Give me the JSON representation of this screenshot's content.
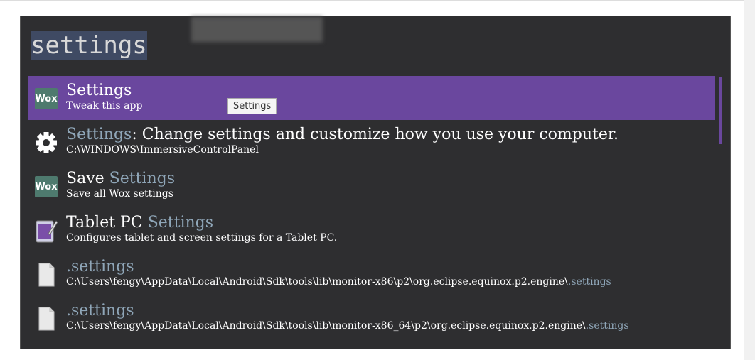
{
  "query": "settings",
  "tooltip": "Settings",
  "accent_color": "#6a479e",
  "highlight_color": "#8fa6b8",
  "results": [
    {
      "icon": "wox-icon",
      "icon_text": "Wox",
      "title_pre": "Settings",
      "title_hl": "",
      "title_post": "",
      "sub_pre": "Tweak this app",
      "sub_hl": "",
      "selected": true
    },
    {
      "icon": "gear-icon",
      "title_pre": "",
      "title_hl": "Settings",
      "title_post": ": Change settings and customize how you use your computer.",
      "sub_pre": "C:\\WINDOWS\\ImmersiveControlPanel",
      "sub_hl": ""
    },
    {
      "icon": "wox-icon",
      "icon_text": "Wox",
      "title_pre": "Save ",
      "title_hl": "Settings",
      "title_post": "",
      "sub_pre": "Save all Wox settings",
      "sub_hl": ""
    },
    {
      "icon": "tablet-pc-icon",
      "title_pre": "Tablet PC ",
      "title_hl": "Settings",
      "title_post": "",
      "sub_pre": "Configures tablet and screen settings for a Tablet PC.",
      "sub_hl": ""
    },
    {
      "icon": "file-icon",
      "title_pre": "",
      "title_hl": ".settings",
      "title_post": "",
      "sub_pre": "C:\\Users\\fengy\\AppData\\Local\\Android\\Sdk\\tools\\lib\\monitor-x86\\p2\\org.eclipse.equinox.p2.engine\\",
      "sub_hl": ".settings"
    },
    {
      "icon": "file-icon",
      "title_pre": "",
      "title_hl": ".settings",
      "title_post": "",
      "sub_pre": "C:\\Users\\fengy\\AppData\\Local\\Android\\Sdk\\tools\\lib\\monitor-x86_64\\p2\\org.eclipse.equinox.p2.engine\\",
      "sub_hl": ".settings"
    }
  ]
}
